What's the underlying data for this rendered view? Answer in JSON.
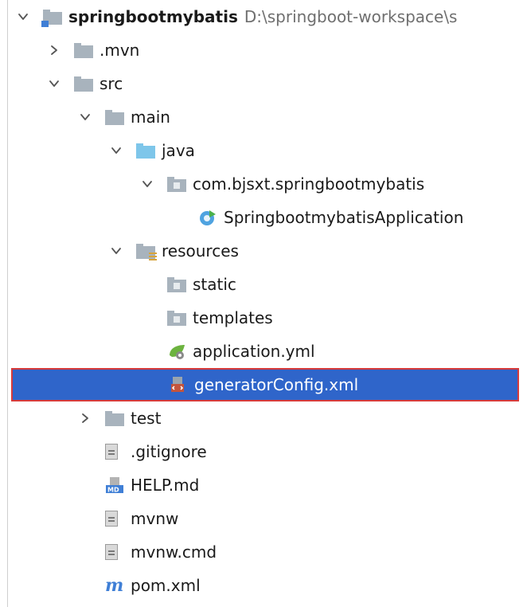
{
  "project": {
    "name": "springbootmybatis",
    "path": "D:\\springboot-workspace\\s"
  },
  "tree": [
    {
      "label": "springbootmybatis",
      "depth": 0,
      "arrow": "down",
      "icon": "module-folder-icon",
      "bold": true
    },
    {
      "label": ".mvn",
      "depth": 1,
      "arrow": "right",
      "icon": "folder-icon"
    },
    {
      "label": "src",
      "depth": 1,
      "arrow": "down",
      "icon": "folder-icon"
    },
    {
      "label": "main",
      "depth": 2,
      "arrow": "down",
      "icon": "folder-icon"
    },
    {
      "label": "java",
      "depth": 3,
      "arrow": "down",
      "icon": "source-folder-icon"
    },
    {
      "label": "com.bjsxt.springbootmybatis",
      "depth": 4,
      "arrow": "down",
      "icon": "package-icon"
    },
    {
      "label": "SpringbootmybatisApplication",
      "depth": 5,
      "arrow": "none",
      "icon": "spring-boot-class-icon"
    },
    {
      "label": "resources",
      "depth": 3,
      "arrow": "down",
      "icon": "resources-folder-icon"
    },
    {
      "label": "static",
      "depth": 4,
      "arrow": "none",
      "icon": "package-icon"
    },
    {
      "label": "templates",
      "depth": 4,
      "arrow": "none",
      "icon": "package-icon"
    },
    {
      "label": "application.yml",
      "depth": 4,
      "arrow": "none",
      "icon": "spring-config-icon"
    },
    {
      "label": "generatorConfig.xml",
      "depth": 4,
      "arrow": "none",
      "icon": "xml-file-icon",
      "selected": true
    },
    {
      "label": "test",
      "depth": 2,
      "arrow": "right",
      "icon": "folder-icon"
    },
    {
      "label": ".gitignore",
      "depth": 2,
      "arrow": "none",
      "icon": "text-file-icon"
    },
    {
      "label": "HELP.md",
      "depth": 2,
      "arrow": "none",
      "icon": "markdown-file-icon"
    },
    {
      "label": "mvnw",
      "depth": 2,
      "arrow": "none",
      "icon": "text-file-icon"
    },
    {
      "label": "mvnw.cmd",
      "depth": 2,
      "arrow": "none",
      "icon": "text-file-icon"
    },
    {
      "label": "pom.xml",
      "depth": 2,
      "arrow": "none",
      "icon": "maven-icon"
    }
  ],
  "colors": {
    "selection": "#2f65ca",
    "selection_outline": "#d63b3b",
    "folder": "#a8b3bd",
    "source_folder": "#7ec6ea",
    "path_text": "#6f6f6f"
  }
}
